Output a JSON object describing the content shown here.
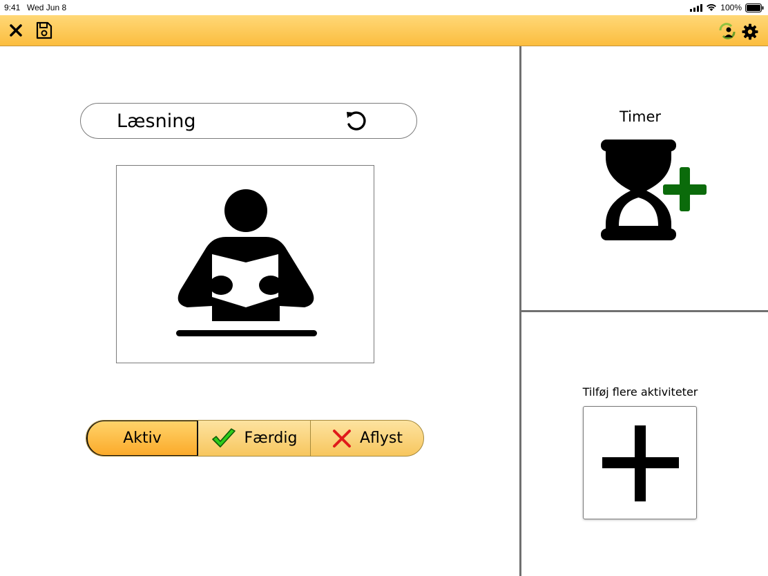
{
  "status_bar": {
    "time": "9:41",
    "date": "Wed Jun 8",
    "battery": "100%"
  },
  "toolbar": {
    "close_icon": "close-icon",
    "save_icon": "save-icon",
    "user_sync_icon": "user-sync-icon",
    "settings_icon": "gear-icon"
  },
  "activity": {
    "title": "Læsning",
    "picture_icon": "reading-person-icon"
  },
  "status_selector": {
    "options": [
      {
        "label": "Aktiv",
        "selected": true
      },
      {
        "label": "Færdig",
        "icon": "checkmark-icon"
      },
      {
        "label": "Aflyst",
        "icon": "cross-icon"
      }
    ]
  },
  "timer": {
    "label": "Timer",
    "icon": "hourglass-add-icon"
  },
  "add_activities": {
    "label": "Tilføj flere aktiviteter",
    "icon": "plus-icon"
  },
  "colors": {
    "toolbar_top": "#ffd877",
    "toolbar_bottom": "#fbbd3f",
    "check_green": "#2ecc1a",
    "cross_red": "#e01b1b",
    "timer_plus_green": "#0b6b0b",
    "divider": "#707070"
  }
}
